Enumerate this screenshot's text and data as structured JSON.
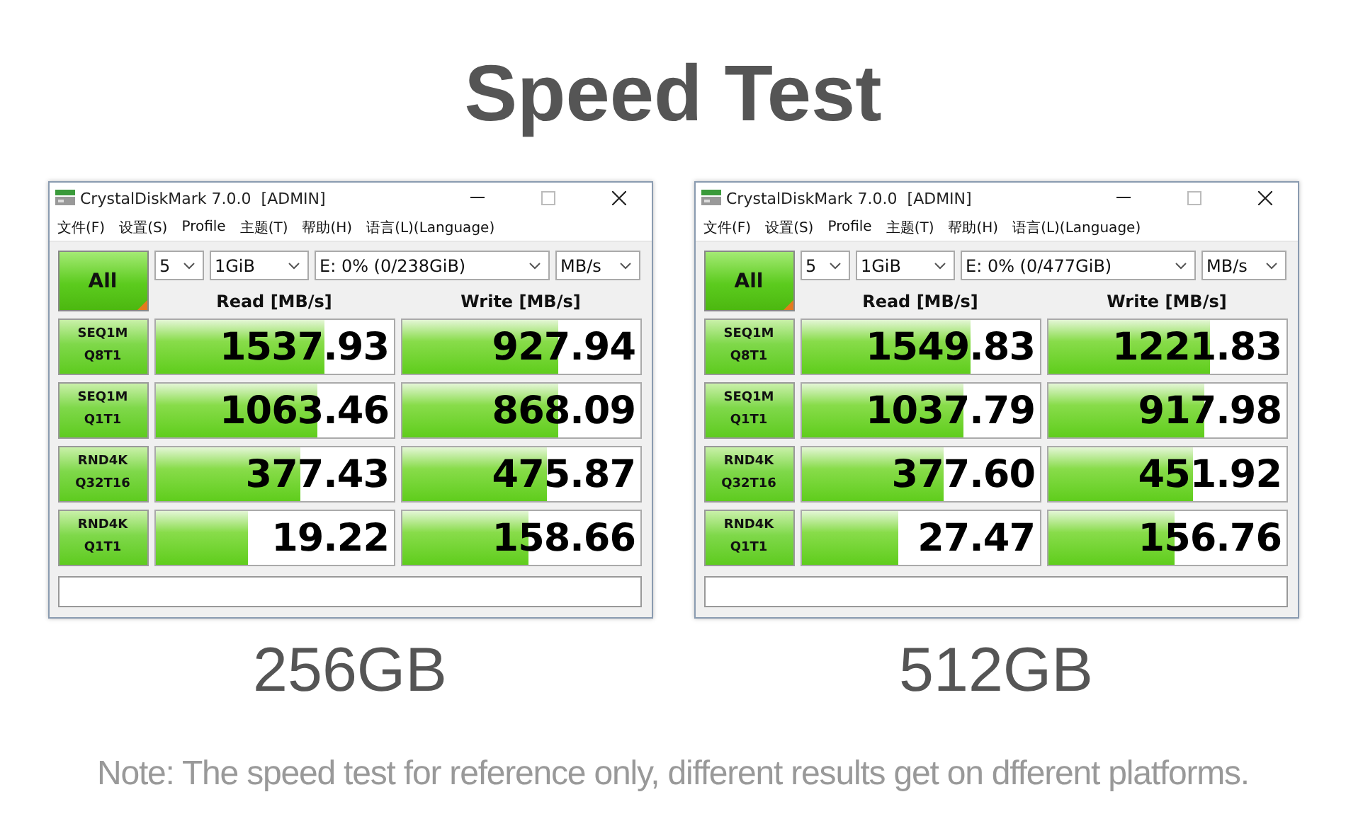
{
  "title": "Speed Test",
  "windows": [
    {
      "title": "CrystalDiskMark 7.0.0  [ADMIN]",
      "menu": [
        "文件(F)",
        "设置(S)",
        "Profile",
        "主题(T)",
        "帮助(H)",
        "语言(L)(Language)"
      ],
      "all_button": "All",
      "count": "5",
      "size": "1GiB",
      "drive": "E: 0% (0/238GiB)",
      "unit": "MB/s",
      "read_header": "Read [MB/s]",
      "write_header": "Write [MB/s]",
      "tests": [
        {
          "name": "SEQ1M",
          "sub": "Q8T1",
          "read": {
            "value": "1537.93",
            "level": 0.71
          },
          "write": {
            "value": "927.94",
            "level": 0.66
          }
        },
        {
          "name": "SEQ1M",
          "sub": "Q1T1",
          "read": {
            "value": "1063.46",
            "level": 0.68
          },
          "write": {
            "value": "868.09",
            "level": 0.66
          }
        },
        {
          "name": "RND4K",
          "sub": "Q32T16",
          "read": {
            "value": "377.43",
            "level": 0.61
          },
          "write": {
            "value": "475.87",
            "level": 0.61
          }
        },
        {
          "name": "RND4K",
          "sub": "Q1T1",
          "read": {
            "value": "19.22",
            "level": 0.39
          },
          "write": {
            "value": "158.66",
            "level": 0.53
          }
        }
      ],
      "caption": "256GB"
    },
    {
      "title": "CrystalDiskMark 7.0.0  [ADMIN]",
      "menu": [
        "文件(F)",
        "设置(S)",
        "Profile",
        "主题(T)",
        "帮助(H)",
        "语言(L)(Language)"
      ],
      "all_button": "All",
      "count": "5",
      "size": "1GiB",
      "drive": "E: 0% (0/477GiB)",
      "unit": "MB/s",
      "read_header": "Read [MB/s]",
      "write_header": "Write [MB/s]",
      "tests": [
        {
          "name": "SEQ1M",
          "sub": "Q8T1",
          "read": {
            "value": "1549.83",
            "level": 0.71
          },
          "write": {
            "value": "1221.83",
            "level": 0.68
          }
        },
        {
          "name": "SEQ1M",
          "sub": "Q1T1",
          "read": {
            "value": "1037.79",
            "level": 0.68
          },
          "write": {
            "value": "917.98",
            "level": 0.66
          }
        },
        {
          "name": "RND4K",
          "sub": "Q32T16",
          "read": {
            "value": "377.60",
            "level": 0.6
          },
          "write": {
            "value": "451.92",
            "level": 0.61
          }
        },
        {
          "name": "RND4K",
          "sub": "Q1T1",
          "read": {
            "value": "27.47",
            "level": 0.41
          },
          "write": {
            "value": "156.76",
            "level": 0.53
          }
        }
      ],
      "caption": "512GB"
    }
  ],
  "note": "Note: The speed test for reference only, different results get on dfferent platforms."
}
